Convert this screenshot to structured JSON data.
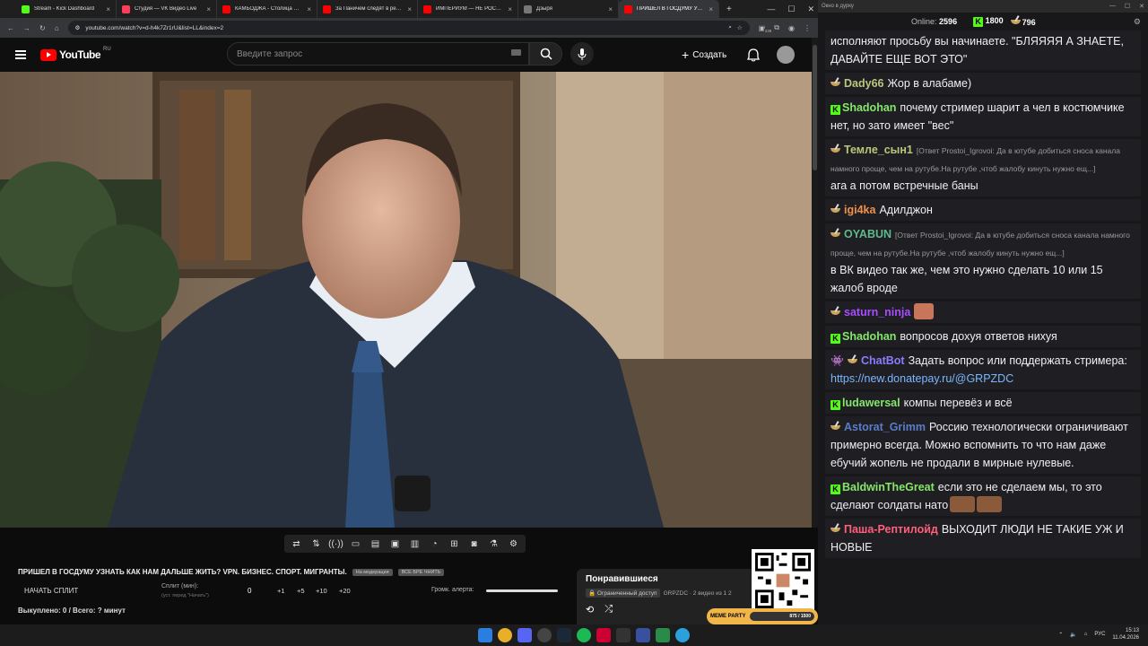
{
  "browser": {
    "tabs": [
      {
        "label": "Stream - Kick Dashboard",
        "color": "#53fc18"
      },
      {
        "label": "Студия — VK Видео Live",
        "color": "#ff3d5a"
      },
      {
        "label": "КАМБОДЖА - Столица Ми...",
        "color": "#ff0000"
      },
      {
        "label": "За Паничем следят в реал...",
        "color": "#ff0000"
      },
      {
        "label": "ИМПЕРИУМ — НЕ РОССИ...",
        "color": "#ff0000"
      },
      {
        "label": "Дзыря",
        "color": "#777777"
      },
      {
        "label": "ПРИШЕЛ В ГОСДУМУ УЗНА...",
        "color": "#ff0000"
      }
    ],
    "new_tab": "+",
    "url": "youtube.com/watch?v=d-h4k7Zr1rU&list=LL&index=2",
    "ext_badge": "238"
  },
  "youtube": {
    "logo": "YouTube",
    "region": "RU",
    "search_placeholder": "Введите запрос",
    "create_label": "Создать"
  },
  "below": {
    "title": "ПРИШЕЛ В ГОСДУМУ УЗНАТЬ КАК НАМ ДАЛЬШЕ ЖИТЬ? VPN. БИЗНЕС. СПОРТ. МИГРАНТЫ.",
    "pill1": "На модерации",
    "pill2": "ВСЕ БРЕ ЧНИТЬ",
    "split_button": "НАЧАТЬ СПЛИТ",
    "split_label": "Сплит (мин):",
    "split_sub": "(уст. перед \"Начать\")",
    "split_value": "0",
    "increments": [
      "+1",
      "+5",
      "+10",
      "+20"
    ],
    "alert_label": "Громк. алерта:",
    "bought": "Выкуплено: 0 / Всего: ? минут"
  },
  "liked": {
    "title": "Понравившиеся",
    "badge": "Ограниченный доступ",
    "meta": "GRPZDC · 2 видео из 1 2"
  },
  "meme": {
    "label": "MEME PARTY",
    "progress": "875 / 1500"
  },
  "tray": {
    "lang": "РУС",
    "time": "15:13",
    "date": "11.04.2026"
  },
  "chat": {
    "window_title": "Окно в дурку",
    "online_label": "Online:",
    "online": "2596",
    "kick_count": "1800",
    "bowl_count": "796",
    "messages": [
      {
        "text": "исполняют просьбу вы начинаете. \"БЛЯЯЯЯ А ЗНАЕТЕ, ДАВАЙТЕ ЕЩЕ ВОТ ЭТО\""
      },
      {
        "badge": "bowl",
        "user": "Dady66",
        "color": "#b9c77c",
        "text": "Жор в алабаме)"
      },
      {
        "badge": "kick",
        "user": "Shadohan",
        "color": "#86e66a",
        "text": "почему стример шарит а чел в костюмчике нет, но зато имеет \"вес\""
      },
      {
        "badge": "bowl",
        "user": "Темле_сын1",
        "color": "#b9c77c",
        "reply": "[Ответ Prostoi_Igrovoi: Да в ютубе добиться сноса канала намного проще, чем на рутубе.На рутубе ,чтоб жалобу кинуть нужно ещ...]",
        "text": "ага а потом встречные баны"
      },
      {
        "badge": "bowl",
        "user": "igi4ka",
        "color": "#f0914a",
        "text": "Адилджон"
      },
      {
        "badge": "bowl",
        "user": "OYABUN",
        "color": "#5fb98c",
        "reply": "[Ответ Prostoi_Igrovoi: Да в ютубе добиться сноса канала намного проще, чем на рутубе.На рутубе ,чтоб жалобу кинуть нужно ещ...]",
        "text": "в ВК видео так же, чем это нужно сделать 10 или 15 жалоб вроде"
      },
      {
        "badge": "bowl",
        "user": "saturn_ninja",
        "color": "#a64dff",
        "text": "",
        "emote": true
      },
      {
        "badge": "kick",
        "user": "Shadohan",
        "color": "#86e66a",
        "text": "вопросов дохуя ответов нихуя"
      },
      {
        "badge": "bot",
        "user": "ChatBot",
        "color": "#8a7cff",
        "text": "Задать вопрос или поддержать стримера:",
        "link": "https://new.donatepay.ru/@GRPZDC"
      },
      {
        "badge": "kick",
        "user": "ludawersal",
        "color": "#86e66a",
        "text": "компы перевёз и всё"
      },
      {
        "badge": "bowl",
        "user": "Astorat_Grimm",
        "color": "#5a7cc9",
        "text": "Россию технологически ограничивают примерно всегда. Можно вспомнить то что нам даже ебучий жопель не продали в мирные нулевые."
      },
      {
        "badge": "kick",
        "user": "BaldwinTheGreat",
        "color": "#86e66a",
        "text": "если это не сделаем мы, то это сделают солдаты нато",
        "emote2": true
      },
      {
        "badge": "bowl",
        "user": "Паша-Рептилойд",
        "color": "#ff5f7a",
        "text": "ВЫХОДИТ ЛЮДИ НЕ ТАКИЕ УЖ И НОВЫЕ"
      }
    ]
  }
}
